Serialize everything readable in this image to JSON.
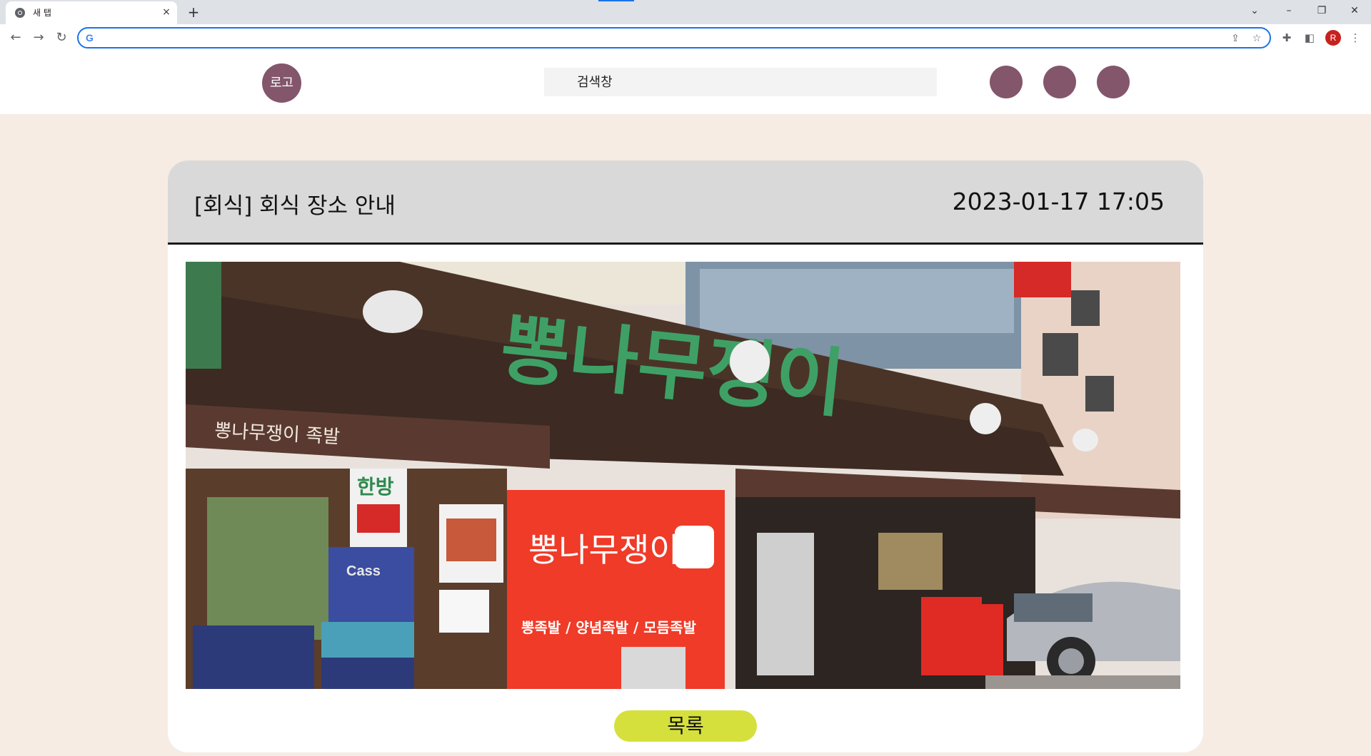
{
  "browser": {
    "tab_title": "새 탭",
    "tab_close": "×",
    "new_tab": "+",
    "address_value": "",
    "profile_initial": "R"
  },
  "header": {
    "logo_label": "로고",
    "search_placeholder": "검색창"
  },
  "post": {
    "title": "[회식] 회식 장소 안내",
    "date": "2023-01-17 17:05",
    "list_button": "목록"
  },
  "photo": {
    "sign_main": "뽕나무쟁이",
    "awning_left": "뽕나무쟁이 족발",
    "board_menu": "뽕족발 / 양념족발 / 모듬족발",
    "board_logo": "뽕나무쟁이",
    "side_sign": "한방",
    "crate_label": "Cass"
  },
  "colors": {
    "page_bg": "#f6ece4",
    "accent_circle": "#83566b",
    "card_header": "#d9d9d9",
    "list_button": "#d5e03d"
  }
}
